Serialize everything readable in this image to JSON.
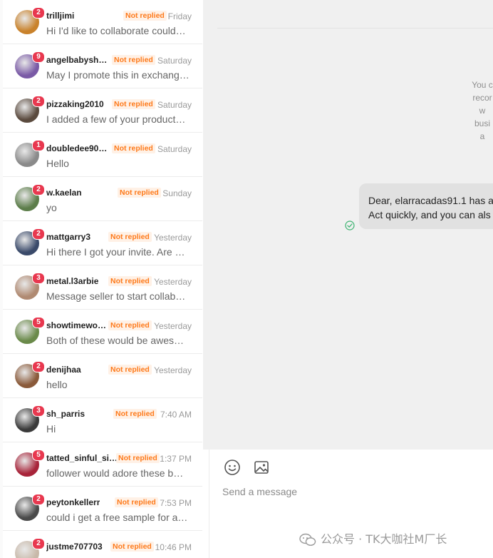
{
  "conversations": [
    {
      "name": "trilljimi",
      "status": "Not replied",
      "time": "Friday",
      "preview": "Hi I'd like to collaborate could…",
      "unread": "2",
      "avatar_color": "#c9822b"
    },
    {
      "name": "angelbabysh…",
      "status": "Not replied",
      "time": "Saturday",
      "preview": "May I promote this in exchang…",
      "unread": "9",
      "avatar_color": "#7a5aa6"
    },
    {
      "name": "pizzaking2010",
      "status": "Not replied",
      "time": "Saturday",
      "preview": "I added a few of your product…",
      "unread": "2",
      "avatar_color": "#5a4a3e"
    },
    {
      "name": "doubledee90…",
      "status": "Not replied",
      "time": "Saturday",
      "preview": "Hello",
      "unread": "1",
      "avatar_color": "#8a8a8a"
    },
    {
      "name": "w.kaelan",
      "status": "Not replied",
      "time": "Sunday",
      "preview": "yo",
      "unread": "2",
      "avatar_color": "#5c7d4a"
    },
    {
      "name": "mattgarry3",
      "status": "Not replied",
      "time": "Yesterday",
      "preview": "Hi there I got your invite. Are …",
      "unread": "2",
      "avatar_color": "#3a4a6a"
    },
    {
      "name": "metal.l3arbie",
      "status": "Not replied",
      "time": "Yesterday",
      "preview": "Message seller to start collab…",
      "unread": "3",
      "avatar_color": "#b08a72"
    },
    {
      "name": "showtimewo…",
      "status": "Not replied",
      "time": "Yesterday",
      "preview": "Both of these would be awes…",
      "unread": "5",
      "avatar_color": "#6a8a4a"
    },
    {
      "name": "denijhaa",
      "status": "Not replied",
      "time": "Yesterday",
      "preview": "hello",
      "unread": "2",
      "avatar_color": "#8a5a3a"
    },
    {
      "name": "sh_parris",
      "status": "Not replied",
      "time": "7:40 AM",
      "preview": "Hi",
      "unread": "3",
      "avatar_color": "#3a3a3a"
    },
    {
      "name": "tatted_sinful_si…",
      "status": "Not replied",
      "time": "1:37 PM",
      "preview": "follower would adore these b…",
      "unread": "5",
      "avatar_color": "#a8243a"
    },
    {
      "name": "peytonkellerr",
      "status": "Not replied",
      "time": "7:53 PM",
      "preview": "could i get a free sample for a…",
      "unread": "2",
      "avatar_color": "#4a4a4a"
    },
    {
      "name": "justme707703",
      "status": "Not replied",
      "time": "10:46 PM",
      "preview": "",
      "unread": "2",
      "avatar_color": "#c8b8a8"
    }
  ],
  "chat": {
    "system_note_lines": [
      "You c",
      "recor",
      "w",
      "busi",
      "a"
    ],
    "message_line1": "Dear, elarracadas91.1 has a",
    "message_line2": "Act quickly, and you can als"
  },
  "composer": {
    "placeholder": "Send a message"
  },
  "watermark": "公众号 · TK大咖社M厂长",
  "colors": {
    "badge": "#e8384f",
    "status_tag": "#fe7a1b",
    "sent_check": "#3cb371"
  }
}
